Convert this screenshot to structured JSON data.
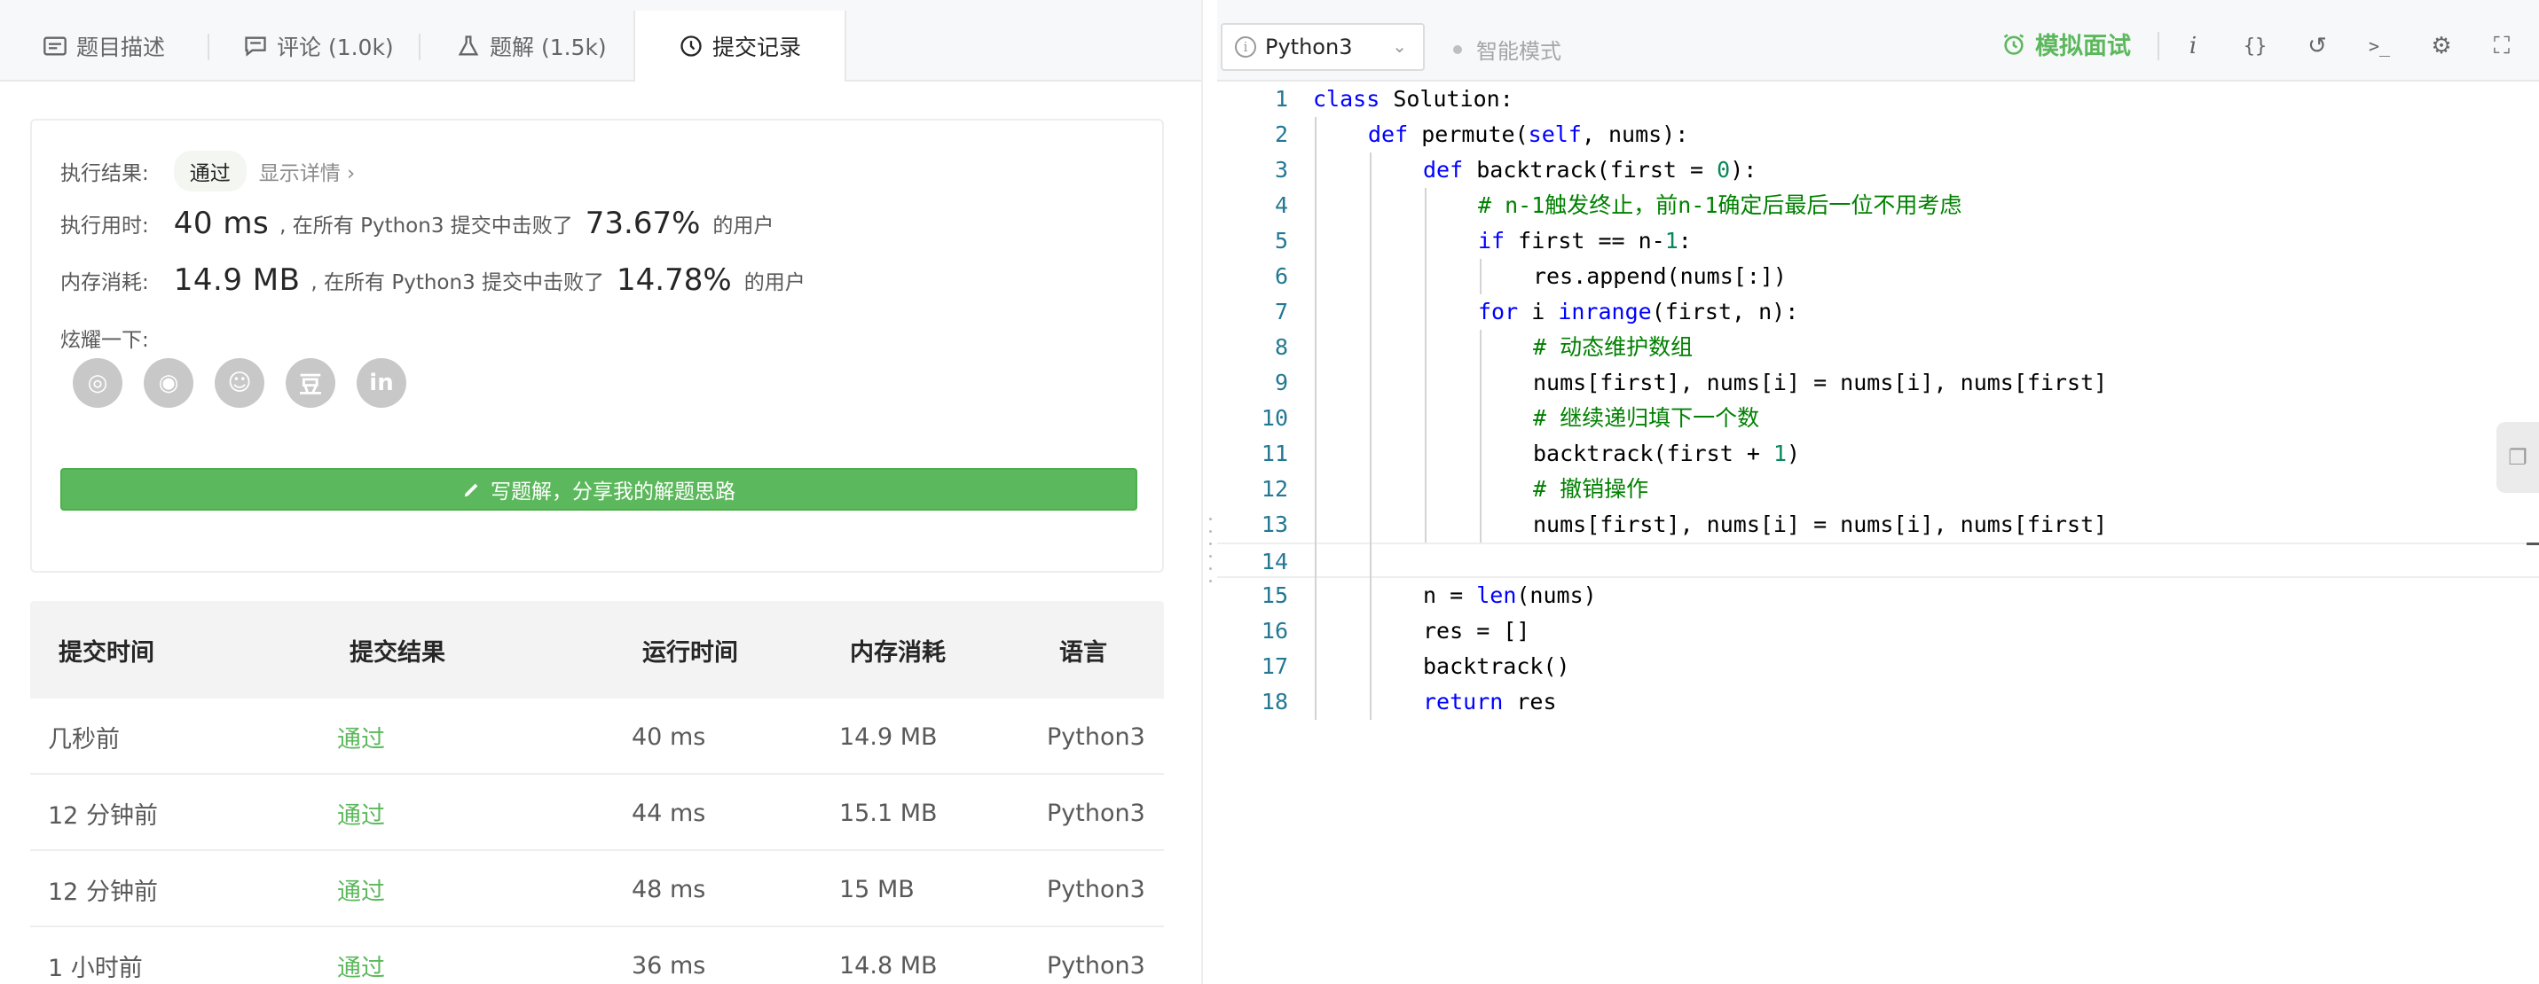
{
  "tabs": [
    {
      "label": "题目描述",
      "icon": "description-icon"
    },
    {
      "label": "评论 (1.0k)",
      "icon": "comment-icon"
    },
    {
      "label": "题解 (1.5k)",
      "icon": "flask-icon"
    },
    {
      "label": "提交记录",
      "icon": "clock-icon"
    }
  ],
  "result": {
    "status_label": "执行结果:",
    "status": "通过",
    "detail_link": "显示详情 ›",
    "time_label": "执行用时:",
    "time_value": "40 ms",
    "time_mid": ", 在所有 Python3 提交中击败了",
    "time_pct": "73.67%",
    "time_suffix": "的用户",
    "mem_label": "内存消耗:",
    "mem_value": "14.9 MB",
    "mem_mid": ", 在所有 Python3 提交中击败了",
    "mem_pct": "14.78%",
    "mem_suffix": "的用户",
    "share_label": "炫耀一下:",
    "share_icons": [
      "wechat-icon",
      "weibo-icon",
      "qq-icon",
      "douban-icon",
      "linkedin-icon"
    ],
    "share_glyphs": [
      "◎",
      "◉",
      "☺",
      "豆",
      "in"
    ],
    "write_button": "写题解，分享我的解题思路",
    "accent": "#5cb85c"
  },
  "submissions": {
    "headers": [
      "提交时间",
      "提交结果",
      "运行时间",
      "内存消耗",
      "语言"
    ],
    "rows": [
      [
        "几秒前",
        "通过",
        "40 ms",
        "14.9 MB",
        "Python3"
      ],
      [
        "12 分钟前",
        "通过",
        "44 ms",
        "15.1 MB",
        "Python3"
      ],
      [
        "12 分钟前",
        "通过",
        "48 ms",
        "15 MB",
        "Python3"
      ],
      [
        "1 小时前",
        "通过",
        "36 ms",
        "14.8 MB",
        "Python3"
      ]
    ]
  },
  "toolbar": {
    "language": "Python3",
    "smart_mode": "智能模式",
    "mock_interview": "模拟面试",
    "buttons": [
      {
        "name": "info-button",
        "glyph": "i"
      },
      {
        "name": "format-button",
        "glyph": "{}"
      },
      {
        "name": "reset-button",
        "glyph": "↺"
      },
      {
        "name": "console-button",
        "glyph": ">_"
      },
      {
        "name": "settings-button",
        "glyph": "⚙"
      },
      {
        "name": "fullscreen-button",
        "glyph": "⛶"
      }
    ]
  },
  "editor": {
    "current_line": 14,
    "lines": [
      {
        "n": "1",
        "indent": 0,
        "tokens": [
          [
            "kw",
            "class"
          ],
          [
            "",
            "Solution:"
          ]
        ]
      },
      {
        "n": "2",
        "indent": 1,
        "tokens": [
          [
            "kw",
            "def"
          ],
          [
            "",
            "permute("
          ],
          [
            "sf",
            "self"
          ],
          [
            "",
            ", nums):"
          ]
        ]
      },
      {
        "n": "3",
        "indent": 2,
        "tokens": [
          [
            "kw",
            "def"
          ],
          [
            "",
            "backtrack(first = "
          ],
          [
            "nm",
            "0"
          ],
          [
            "",
            "):"
          ]
        ]
      },
      {
        "n": "4",
        "indent": 3,
        "tokens": [
          [
            "cm",
            "# n-1触发终止，前n-1确定后最后一位不用考虑"
          ]
        ]
      },
      {
        "n": "5",
        "indent": 3,
        "tokens": [
          [
            "kw",
            "if"
          ],
          [
            "",
            " first == n-"
          ],
          [
            "nm",
            "1"
          ],
          [
            "",
            ":"
          ]
        ]
      },
      {
        "n": "6",
        "indent": 4,
        "tokens": [
          [
            "",
            "res.append(nums[:])"
          ]
        ]
      },
      {
        "n": "7",
        "indent": 3,
        "tokens": [
          [
            "kw",
            "for"
          ],
          [
            "",
            " i "
          ],
          [
            "kw",
            "in"
          ],
          [
            "",
            ""
          ],
          [
            "bi",
            "range"
          ],
          [
            "",
            "(first, n):"
          ]
        ]
      },
      {
        "n": "8",
        "indent": 4,
        "tokens": [
          [
            "cm",
            "# 动态维护数组"
          ]
        ]
      },
      {
        "n": "9",
        "indent": 4,
        "tokens": [
          [
            "",
            "nums[first], nums[i] = nums[i], nums[first]"
          ]
        ]
      },
      {
        "n": "10",
        "indent": 4,
        "tokens": [
          [
            "cm",
            "# 继续递归填下一个数"
          ]
        ]
      },
      {
        "n": "11",
        "indent": 4,
        "tokens": [
          [
            "",
            "backtrack(first + "
          ],
          [
            "nm",
            "1"
          ],
          [
            "",
            ")"
          ]
        ]
      },
      {
        "n": "12",
        "indent": 4,
        "tokens": [
          [
            "cm",
            "# 撤销操作"
          ]
        ]
      },
      {
        "n": "13",
        "indent": 4,
        "tokens": [
          [
            "",
            "nums[first], nums[i] = nums[i], nums[first]"
          ]
        ]
      },
      {
        "n": "14",
        "indent": 0,
        "tokens": []
      },
      {
        "n": "15",
        "indent": 2,
        "tokens": [
          [
            "",
            "n = "
          ],
          [
            "bi",
            "len"
          ],
          [
            "",
            "(nums)"
          ]
        ]
      },
      {
        "n": "16",
        "indent": 2,
        "tokens": [
          [
            "",
            "res = []"
          ]
        ]
      },
      {
        "n": "17",
        "indent": 2,
        "tokens": [
          [
            "",
            "backtrack()"
          ]
        ]
      },
      {
        "n": "18",
        "indent": 2,
        "tokens": [
          [
            "kw",
            "return"
          ],
          [
            "",
            " res"
          ]
        ]
      }
    ]
  }
}
